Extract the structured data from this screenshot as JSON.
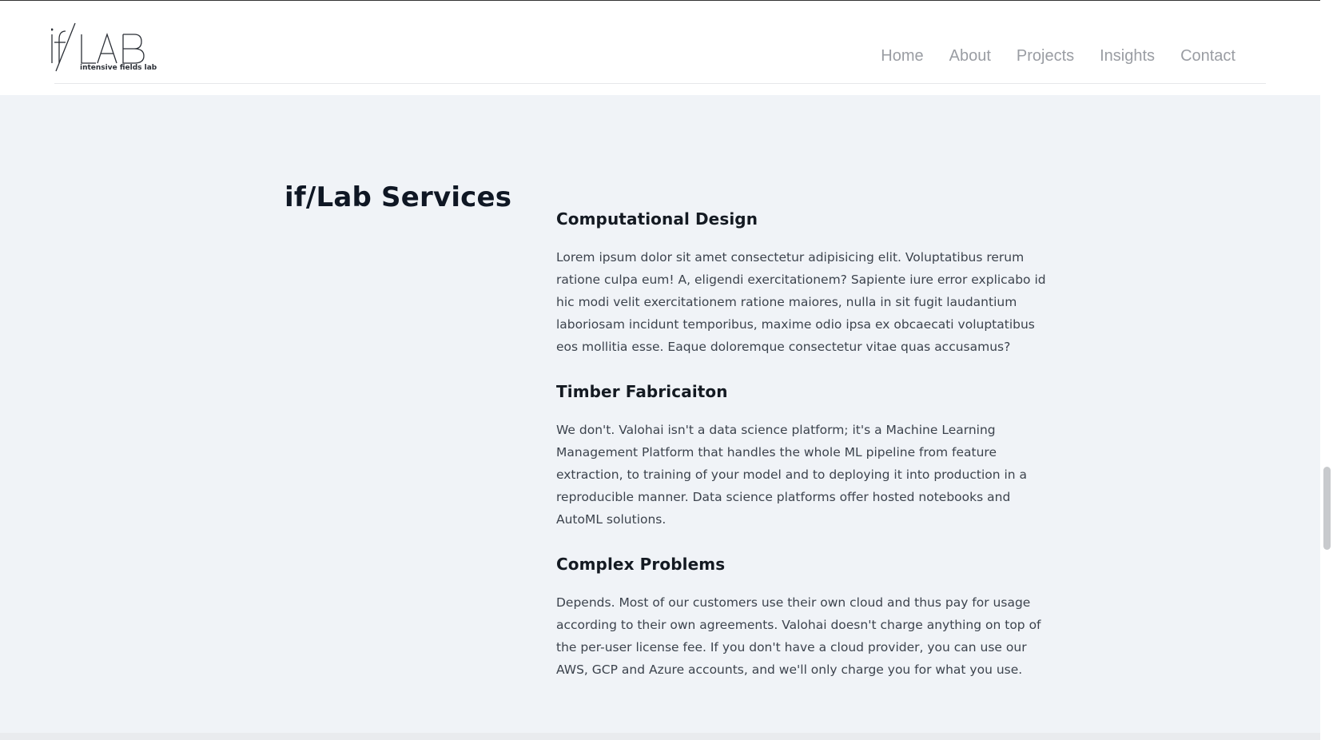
{
  "brand": {
    "logo_text": "if/LAB",
    "logo_tagline": "intensive fields lab"
  },
  "nav": {
    "items": [
      "Home",
      "About",
      "Projects",
      "Insights",
      "Contact"
    ]
  },
  "page": {
    "title": "if/Lab Services"
  },
  "services": [
    {
      "heading": "Computational Design",
      "body": "Lorem ipsum dolor sit amet consectetur adipisicing elit. Voluptatibus rerum ratione culpa eum! A, eligendi exercitationem? Sapiente iure error explicabo id hic modi velit exercitationem ratione maiores, nulla in sit fugit laudantium laboriosam incidunt temporibus, maxime odio ipsa ex obcaecati voluptatibus eos mollitia esse. Eaque doloremque consectetur vitae quas accusamus?"
    },
    {
      "heading": "Timber Fabricaiton",
      "body": "We don't. Valohai isn't a data science platform; it's a Machine Learning Management Platform that handles the whole ML pipeline from feature extraction, to training of your model and to deploying it into production in a reproducible manner. Data science platforms offer hosted notebooks and AutoML solutions."
    },
    {
      "heading": "Complex Problems",
      "body": "Depends. Most of our customers use their own cloud and thus pay for usage according to their own agreements. Valohai doesn't charge anything on top of the per-user license fee. If you don't have a cloud provider, you can use our AWS, GCP and Azure accounts, and we'll only charge you for what you use."
    }
  ],
  "colors": {
    "nav_text": "#9a9da3",
    "title": "#0f1724",
    "body_text": "#3c434d",
    "section_bg": "#f0f3f7"
  }
}
